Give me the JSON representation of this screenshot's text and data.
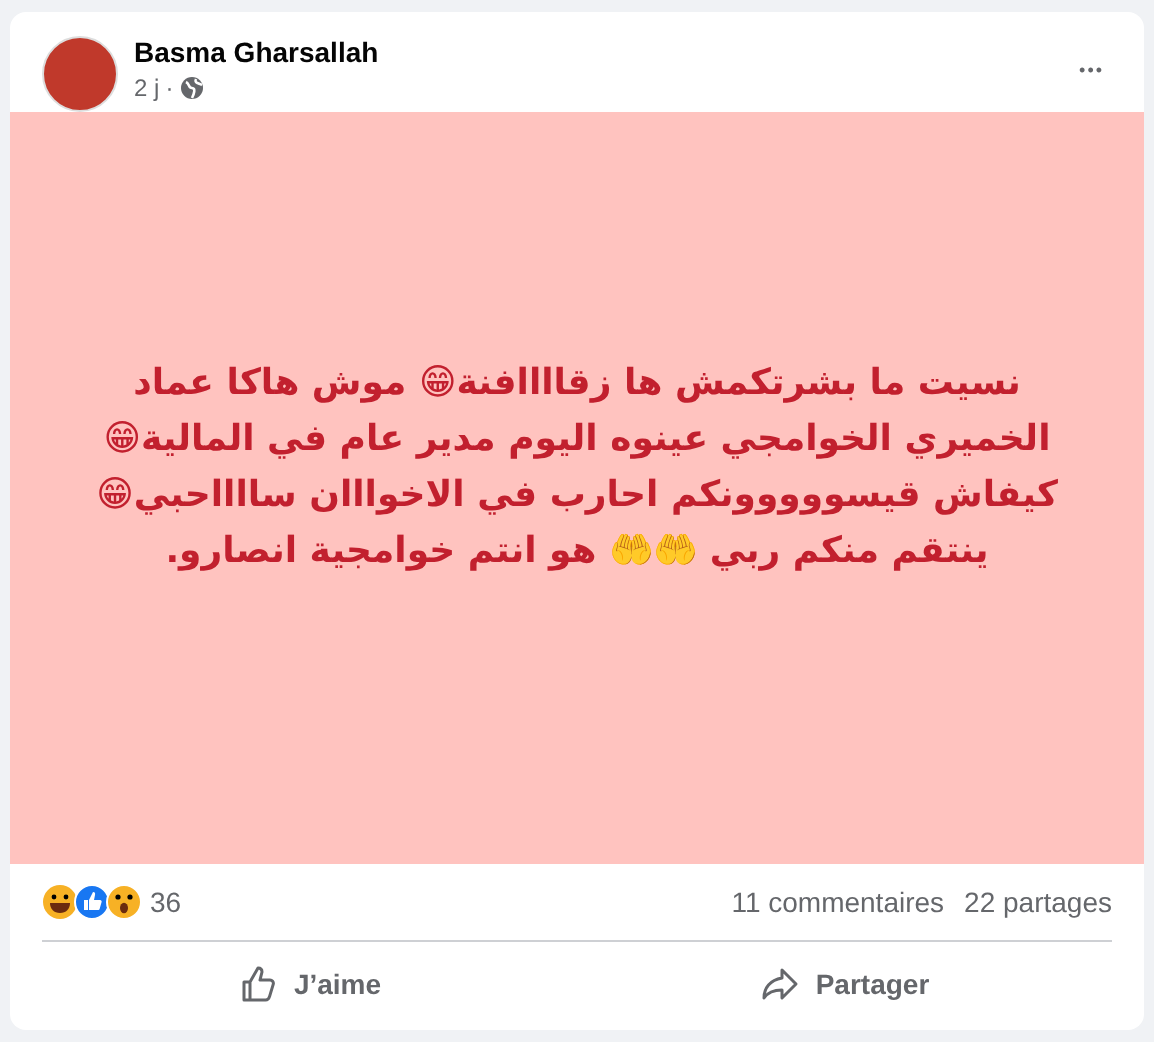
{
  "post": {
    "author": "Basma Gharsallah",
    "time": "2 j",
    "separator": "·",
    "text": "نسيت ما بشرتكمش ها زقاااافنة😁 موش هاكا عماد الخميري الخوامجي عينوه اليوم مدير عام في المالية😁 كيفاش قيسووووونكم احارب في الاخوااان سااااحبي😁 ينتقم منكم ربي 🤲🤲 هو انتم خوامجية انصارو.",
    "more": "•••"
  },
  "reactions": {
    "count": "36",
    "comments": "11 commentaires",
    "shares": "22 partages"
  },
  "like_button": {
    "label": "J’aime"
  },
  "share_button": {
    "label": "Partager"
  }
}
